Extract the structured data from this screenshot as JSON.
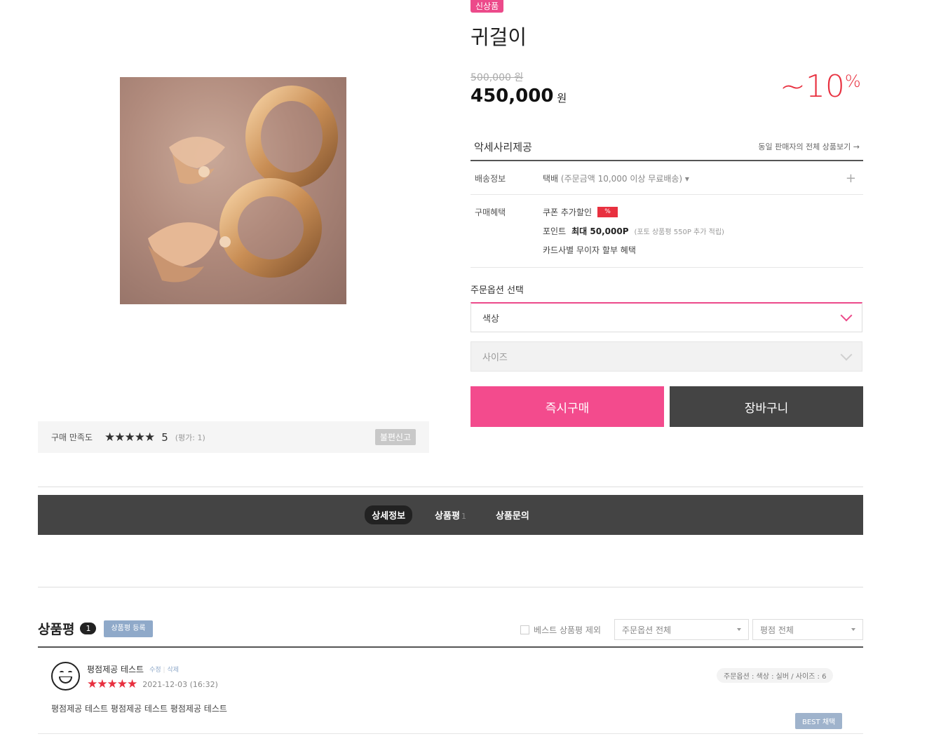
{
  "product": {
    "badge": "신상품",
    "title": "귀걸이",
    "original_price": "500,000 원",
    "price": "450,000",
    "price_unit": "원",
    "discount": "~10",
    "discount_unit": "%"
  },
  "satisfaction": {
    "label": "구매 만족도",
    "stars": "★★★★★",
    "score": "5",
    "count": "(평가: 1)",
    "report_button": "불편신고"
  },
  "seller": {
    "name": "악세사리제공",
    "link": "동일 판매자의 전체 상품보기 →"
  },
  "shipping": {
    "label": "배송정보",
    "method": "택배",
    "detail": "(주문금액 10,000 이상 무료배송) ▾",
    "expand": "+"
  },
  "benefits": {
    "label": "구매혜택",
    "coupon": "쿠폰 추가할인",
    "coupon_badge": "%",
    "point_label": "포인트",
    "point_value": "최대 50,000P",
    "point_note": "(포토 상품평 550P 추가 적립)",
    "card": "카드사별 무이자 할부 혜택"
  },
  "options": {
    "title": "주문옵션 선택",
    "color_placeholder": "색상",
    "size_placeholder": "사이즈"
  },
  "actions": {
    "buy_now": "즉시구매",
    "cart": "장바구니"
  },
  "tabs": [
    {
      "label": "상세정보",
      "count": ""
    },
    {
      "label": "상품평",
      "count": "1"
    },
    {
      "label": "상품문의",
      "count": ""
    }
  ],
  "reviews": {
    "title": "상품평",
    "count": "1",
    "write_button": "상품평 등록",
    "exclude_best": "베스트 상품평 제외",
    "option_filter": "주문옵션 전체",
    "rating_filter": "평점 전체",
    "items": [
      {
        "author": "평점제공 테스트",
        "edit": "수정",
        "delete": "삭제",
        "stars": "★★★★★",
        "date": "2021-12-03 (16:32)",
        "option": "주문옵션 : 색상 : 실버 / 사이즈 : 6",
        "body": "평점제공 테스트 평점제공 테스트 평점제공 테스트",
        "best_button": "BEST 채택"
      }
    ]
  },
  "colors": {
    "accent_pink": "#f34b8d",
    "discount_red": "#e8303f",
    "dark": "#444444",
    "review_blue": "#8fa9c9"
  }
}
